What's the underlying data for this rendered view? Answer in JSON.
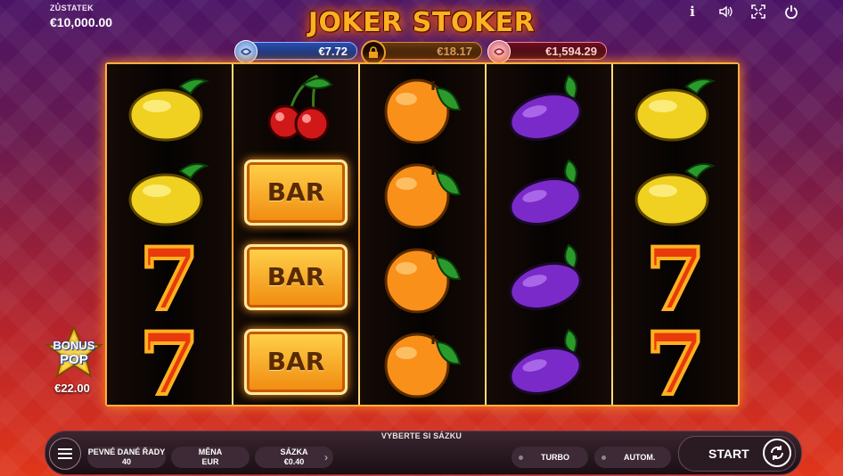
{
  "balance": {
    "label": "ZŮSTATEK",
    "value": "€10,000.00"
  },
  "title": "JOKER STOKER",
  "top_icons": [
    "info-icon",
    "sound-icon",
    "fullscreen-icon",
    "power-icon"
  ],
  "info_glyph": "i",
  "jackpots": {
    "blue": "€7.72",
    "gold": "€18.17",
    "red": "€1,594.29"
  },
  "reels": [
    [
      "lemon",
      "lemon",
      "seven",
      "seven"
    ],
    [
      "cherry",
      "bar",
      "bar",
      "bar"
    ],
    [
      "orange",
      "orange",
      "orange",
      "orange"
    ],
    [
      "plum",
      "plum",
      "plum",
      "plum"
    ],
    [
      "lemon",
      "lemon",
      "seven",
      "seven"
    ]
  ],
  "symbols": {
    "bar_text": "BAR",
    "seven_text": "7"
  },
  "bonus": {
    "line1": "BONUS",
    "line2": "POP",
    "amount": "€22.00"
  },
  "bottom": {
    "hint": "VYBERTE SI SÁZKU",
    "lines_label": "PEVNÉ DANÉ ŘADY",
    "lines_value": "40",
    "currency_label": "MĚNA",
    "currency_value": "EUR",
    "bet_label": "SÁZKA",
    "bet_value": "€0.40",
    "bet_arrow": "›",
    "turbo": "TURBO",
    "auto": "AUTOM.",
    "start": "START"
  },
  "colors": {
    "accent": "#ffb040",
    "frame": "#ff8a20",
    "bg_top": "#4a1466",
    "bg_bottom": "#e0361a"
  }
}
